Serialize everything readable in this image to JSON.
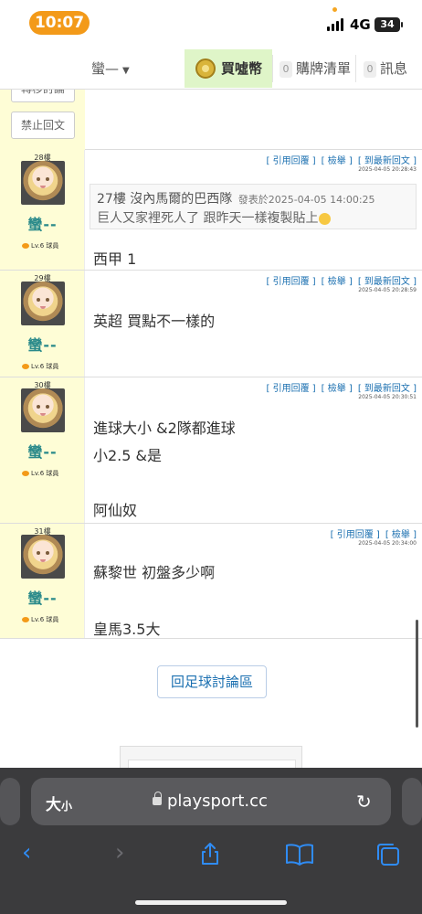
{
  "status_bar": {
    "time": "10:07",
    "network": "4G",
    "battery": "34"
  },
  "topnav": {
    "user": "蠻—",
    "buy_label": "買噓幣",
    "cart": {
      "count": "0",
      "label": "購牌清單"
    },
    "messages": {
      "count": "0",
      "label": "訊息"
    }
  },
  "admin": {
    "button1": "轉移討論",
    "button2": "禁止回文"
  },
  "posts": [
    {
      "floor": "28樓",
      "username": "蠻--",
      "level": "Lv.6 球員",
      "actions": [
        "[ 引用回覆 ]",
        "[ 檢舉 ]",
        "[ 到最新回文 ]"
      ],
      "timestamp": "2025-04-05 20:28:43",
      "quote": {
        "head": "27樓 沒內馬爾的巴西隊",
        "posted": "發表於2025-04-05 14:00:25",
        "body": "巨人又家裡死人了 跟昨天一樣複製貼上"
      },
      "lines": [
        "西甲 1"
      ]
    },
    {
      "floor": "29樓",
      "username": "蠻--",
      "level": "Lv.6 球員",
      "actions": [
        "[ 引用回覆 ]",
        "[ 檢舉 ]",
        "[ 到最新回文 ]"
      ],
      "timestamp": "2025-04-05 20:28:59",
      "lines": [
        "英超 買點不一樣的"
      ]
    },
    {
      "floor": "30樓",
      "username": "蠻--",
      "level": "Lv.6 球員",
      "actions": [
        "[ 引用回覆 ]",
        "[ 檢舉 ]",
        "[ 到最新回文 ]"
      ],
      "timestamp": "2025-04-05 20:30:51",
      "lines": [
        "進球大小 &2隊都進球",
        "小2.5 &是",
        "阿仙奴"
      ]
    },
    {
      "floor": "31樓",
      "username": "蠻--",
      "level": "Lv.6 球員",
      "actions": [
        "[ 引用回覆 ]",
        "[ 檢舉 ]"
      ],
      "timestamp": "2025-04-05 20:34:00",
      "lines": [
        "蘇黎世 初盤多少啊",
        "皇馬3.5大"
      ]
    }
  ],
  "back_button": "回足球討論區",
  "browser": {
    "text_size_label": "大",
    "text_size_small": "小",
    "url": "playsport.cc"
  },
  "icons": {
    "reload": "reload-icon",
    "back": "back-arrow-icon",
    "forward": "forward-arrow-icon",
    "share": "share-icon",
    "bookmarks": "book-icon",
    "tabs": "tabs-icon"
  },
  "colors": {
    "accent": "#f39a19",
    "link": "#1a6fb0",
    "sidebar": "#fefdd6",
    "username": "#2a8a8a",
    "buy_bg": "#dff5c8"
  }
}
